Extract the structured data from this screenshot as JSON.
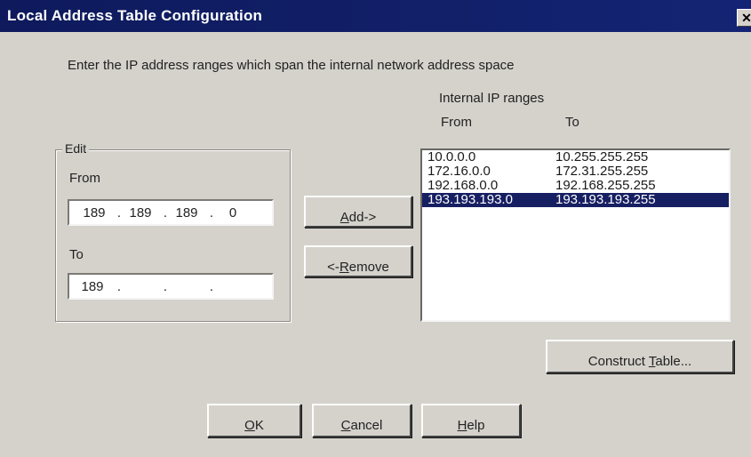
{
  "window": {
    "title": "Local Address Table Configuration",
    "close_glyph": "✕"
  },
  "instruction": "Enter the IP address ranges which span the internal network address space",
  "ranges": {
    "label": "Internal IP ranges",
    "col_from": "From",
    "col_to": "To",
    "rows": [
      {
        "from": "10.0.0.0",
        "to": "10.255.255.255",
        "selected": false
      },
      {
        "from": "172.16.0.0",
        "to": "172.31.255.255",
        "selected": false
      },
      {
        "from": "192.168.0.0",
        "to": "192.168.255.255",
        "selected": false
      },
      {
        "from": "193.193.193.0",
        "to": "193.193.193.255",
        "selected": true
      }
    ]
  },
  "edit": {
    "legend": "Edit",
    "from_label": "From",
    "to_label": "To",
    "from_octets": [
      "189",
      "189",
      "189",
      "0"
    ],
    "to_octets": [
      "189",
      "",
      "",
      ""
    ],
    "dot": "."
  },
  "buttons": {
    "add": {
      "pre": "",
      "key": "A",
      "post": "dd->"
    },
    "remove": {
      "pre": "<-",
      "key": "R",
      "post": "emove"
    },
    "construct": {
      "pre": "Construct ",
      "key": "T",
      "post": "able..."
    },
    "ok": {
      "pre": "",
      "key": "O",
      "post": "K"
    },
    "cancel": {
      "pre": "",
      "key": "C",
      "post": "ancel"
    },
    "help": {
      "pre": "",
      "key": "H",
      "post": "elp"
    }
  },
  "colors": {
    "titlebar": "#12206a",
    "selection": "#161f62",
    "dialog_bg": "#d5d2cc"
  }
}
